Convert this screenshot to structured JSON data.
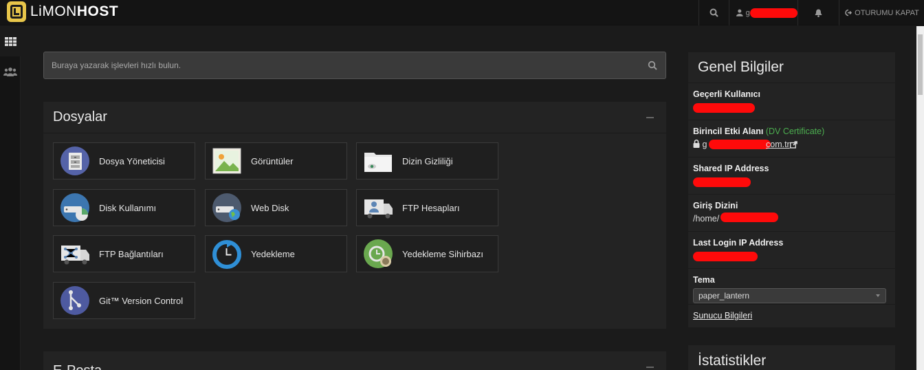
{
  "brand": {
    "name_light": "LiMON",
    "name_bold": "HOST"
  },
  "topbar": {
    "logout_label": "OTURUMU KAPAT",
    "user_initial": "g"
  },
  "search": {
    "placeholder": "Buraya yazarak işlevleri hızlı bulun."
  },
  "files_panel": {
    "title": "Dosyalar",
    "items": [
      {
        "label": "Dosya Yöneticisi",
        "icon": "file-cabinet-icon"
      },
      {
        "label": "Görüntüler",
        "icon": "image-icon"
      },
      {
        "label": "Dizin Gizliliği",
        "icon": "folder-eye-icon"
      },
      {
        "label": "Disk Kullanımı",
        "icon": "disk-usage-icon"
      },
      {
        "label": "Web Disk",
        "icon": "web-disk-icon"
      },
      {
        "label": "FTP Hesapları",
        "icon": "ftp-accounts-icon"
      },
      {
        "label": "FTP Bağlantıları",
        "icon": "ftp-connections-icon"
      },
      {
        "label": "Yedekleme",
        "icon": "backup-icon"
      },
      {
        "label": "Yedekleme Sihirbazı",
        "icon": "backup-wizard-icon"
      },
      {
        "label": "Git™ Version Control",
        "icon": "git-icon"
      }
    ]
  },
  "email_panel": {
    "title": "E-Posta"
  },
  "general_info": {
    "title": "Genel Bilgiler",
    "current_user_label": "Geçerli Kullanıcı",
    "primary_domain_label": "Birincil Etki Alanı",
    "dv_prefix": "(",
    "dv_link": "DV Certificate",
    "dv_suffix": ")",
    "domain_visible_start": "g",
    "domain_visible_end": "com.tr",
    "shared_ip_label": "Shared IP Address",
    "home_dir_label": "Giriş Dizini",
    "home_dir_prefix": "/home/",
    "last_login_label": "Last Login IP Address",
    "theme_label": "Tema",
    "theme_value": "paper_lantern",
    "server_info_link": "Sunucu Bilgileri"
  },
  "stats_panel": {
    "title": "İstatistikler"
  },
  "colors": {
    "accent_green": "#4caf50",
    "redaction": "#ff0a0a",
    "logo_yellow": "#e8c64a"
  }
}
